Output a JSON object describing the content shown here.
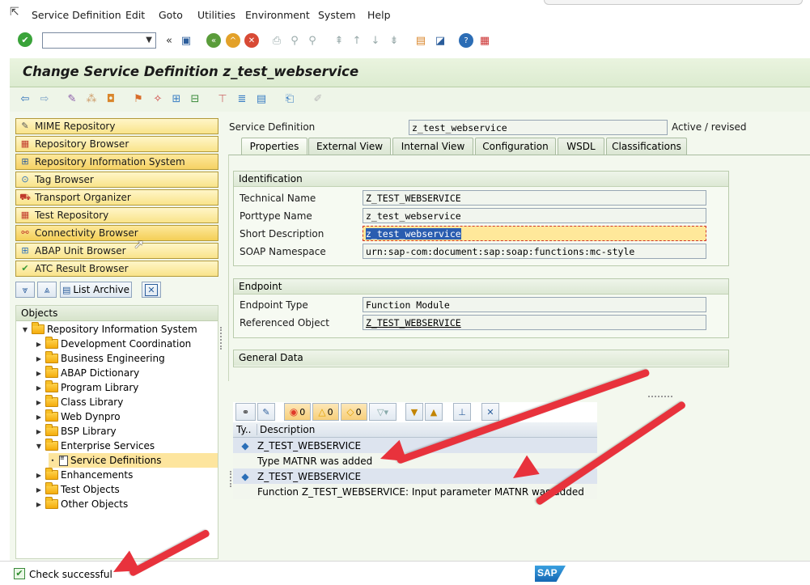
{
  "menubar": {
    "items": [
      "Service Definition",
      "Edit",
      "Goto",
      "Utilities",
      "Environment",
      "System",
      "Help"
    ]
  },
  "toolbar": {
    "command_value": ""
  },
  "title": "Change Service Definition z_test_webservice",
  "nav_buttons": [
    "MIME Repository",
    "Repository Browser",
    "Repository Information System",
    "Tag Browser",
    "Transport Organizer",
    "Test Repository",
    "Connectivity Browser",
    "ABAP Unit Browser",
    "ATC Result Browser"
  ],
  "list_archive_label": "List Archive",
  "tree": {
    "header": "Objects",
    "items": [
      {
        "label": "Repository Information System"
      },
      {
        "label": "Development Coordination"
      },
      {
        "label": "Business Engineering"
      },
      {
        "label": "ABAP Dictionary"
      },
      {
        "label": "Program Library"
      },
      {
        "label": "Class Library"
      },
      {
        "label": "Web Dynpro"
      },
      {
        "label": "BSP Library"
      },
      {
        "label": "Enterprise Services"
      },
      {
        "label": "Service Definitions"
      },
      {
        "label": "Enhancements"
      },
      {
        "label": "Test Objects"
      },
      {
        "label": "Other Objects"
      }
    ]
  },
  "header": {
    "label": "Service Definition",
    "value": "z_test_webservice",
    "status": "Active / revised"
  },
  "tabs": [
    "Properties",
    "External View",
    "Internal View",
    "Configuration",
    "WSDL",
    "Classifications"
  ],
  "identification": {
    "title": "Identification",
    "fields": [
      {
        "label": "Technical Name",
        "value": "Z_TEST_WEBSERVICE"
      },
      {
        "label": "Porttype Name",
        "value": "z_test_webservice"
      },
      {
        "label": "Short Description",
        "value": "z_test_webservice"
      },
      {
        "label": "SOAP Namespace",
        "value": "urn:sap-com:document:sap:soap:functions:mc-style"
      }
    ]
  },
  "endpoint": {
    "title": "Endpoint",
    "fields": [
      {
        "label": "Endpoint Type",
        "value": "Function Module"
      },
      {
        "label": "Referenced Object",
        "value": "Z_TEST_WEBSERVICE"
      }
    ]
  },
  "general_data": {
    "title": "General Data"
  },
  "messages": {
    "counts": [
      "0",
      "0",
      "0"
    ],
    "col_type": "Ty..",
    "col_desc": "Description",
    "rows": [
      "Z_TEST_WEBSERVICE",
      "Type MATNR was added",
      "Z_TEST_WEBSERVICE",
      "Function Z_TEST_WEBSERVICE: Input parameter MATNR was added"
    ]
  },
  "status": {
    "text": "Check successful"
  },
  "brand": "SAP",
  "colors": {
    "title_bg": "#dcebd0",
    "nav_button": "#f9e48a",
    "arrow": "#e8323c",
    "selection": "#fde59e"
  }
}
